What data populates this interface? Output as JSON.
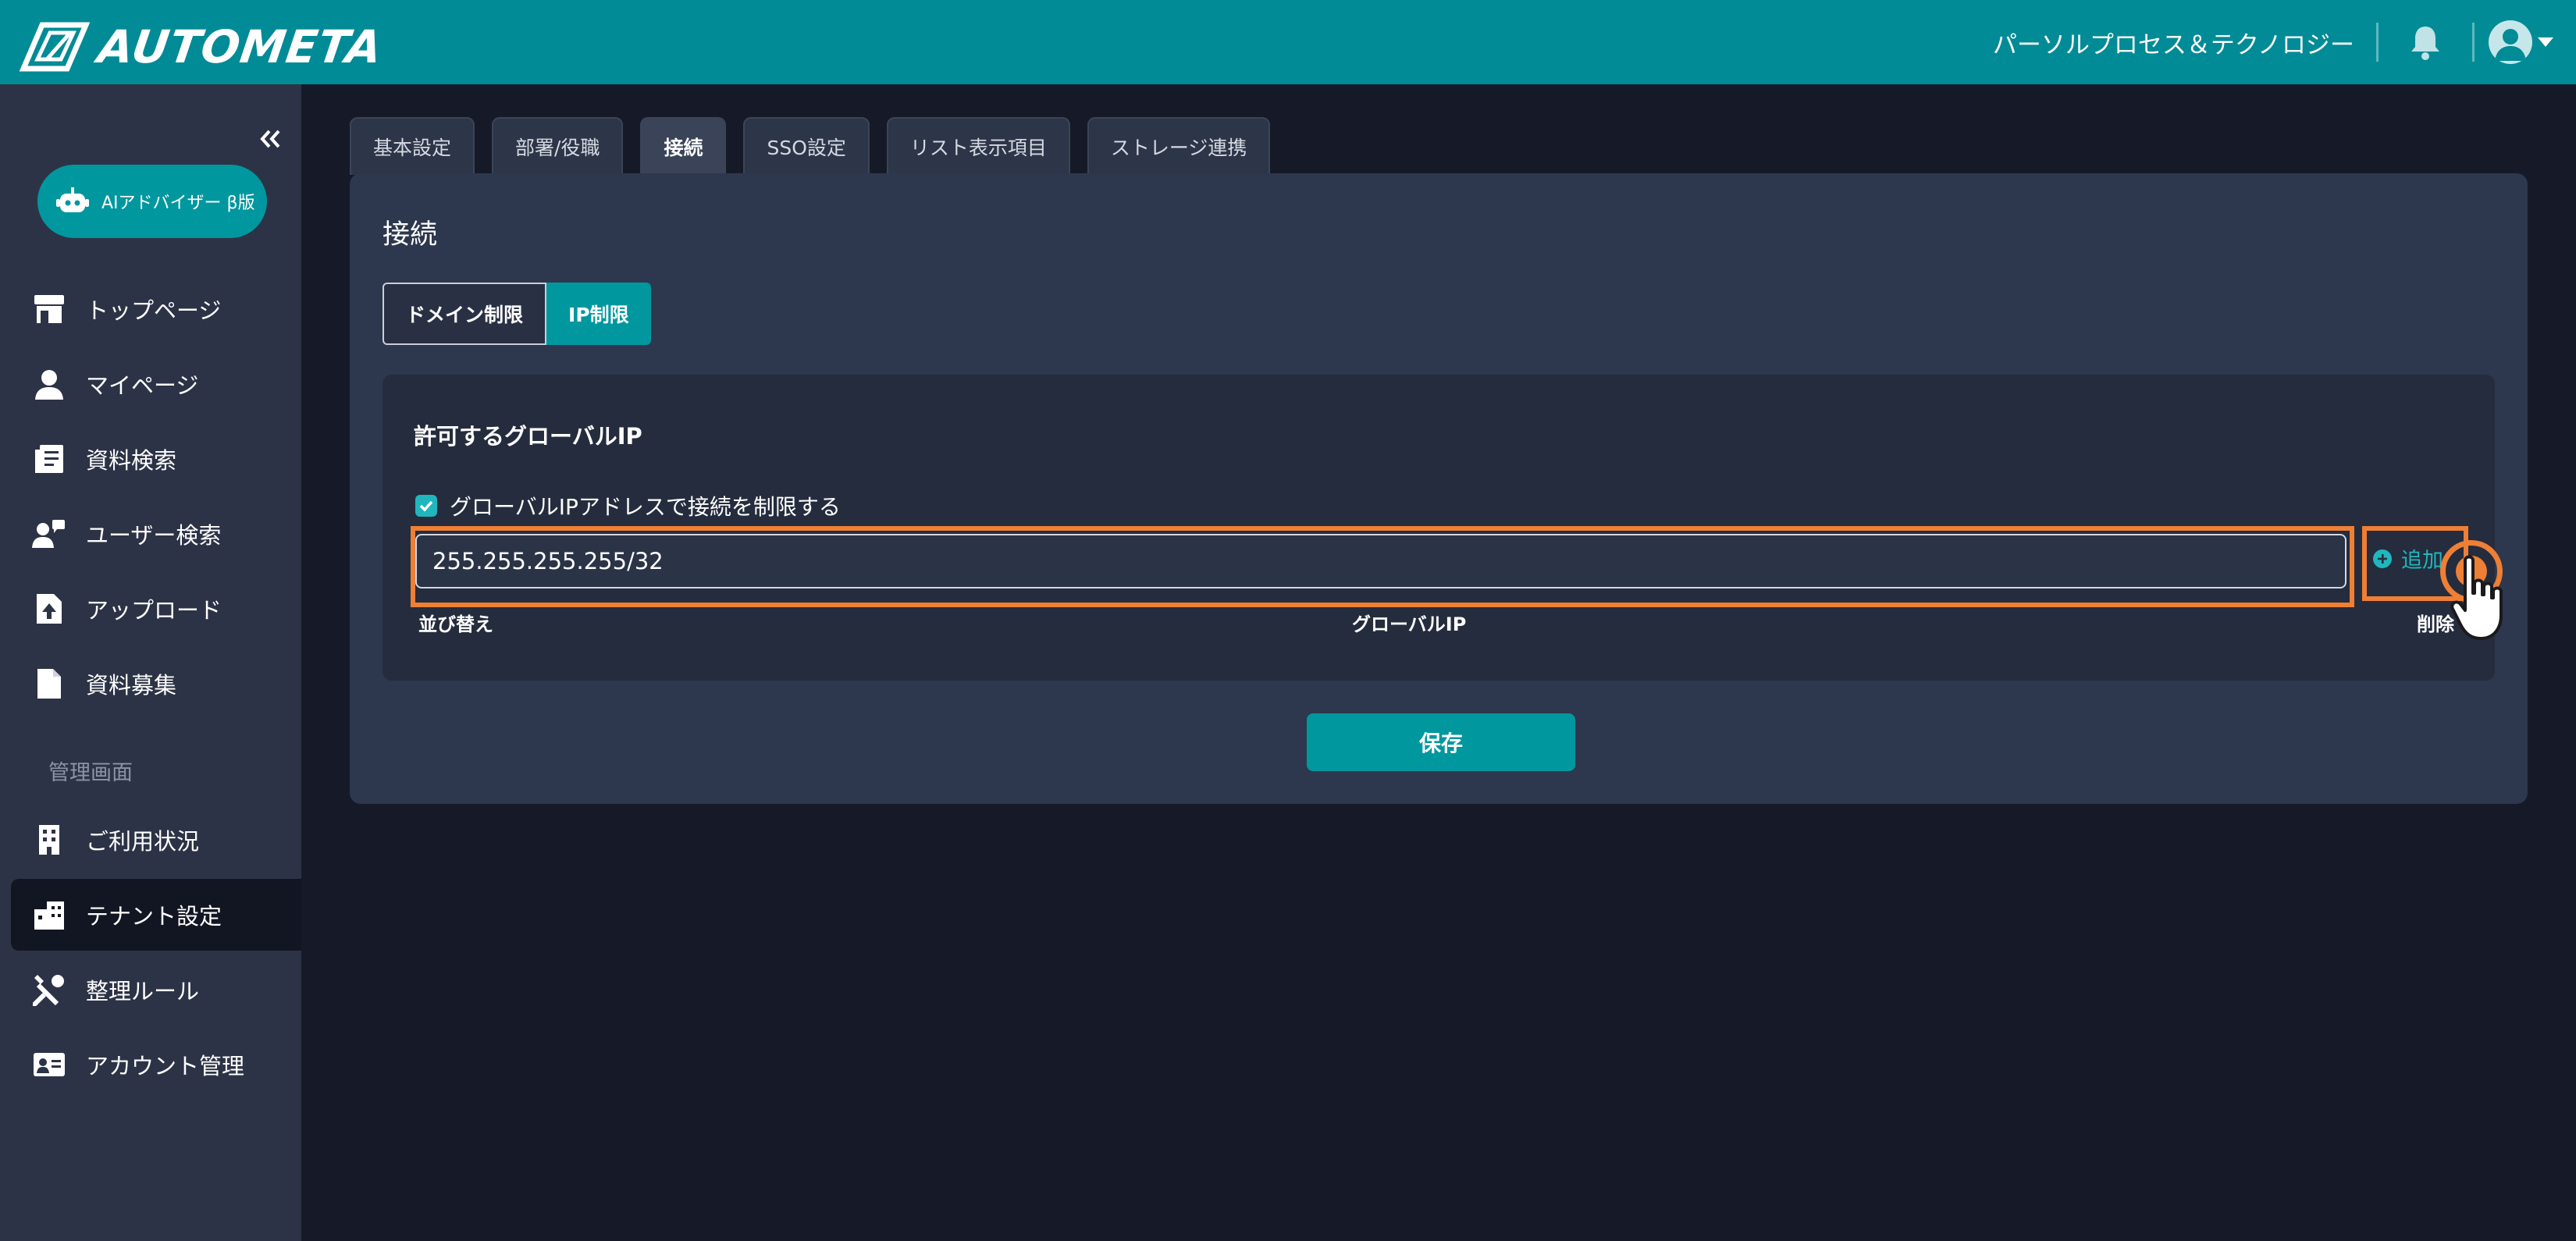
{
  "app": {
    "logo_text": "AUTOMETA",
    "company_name": "パーソルプロセス＆テクノロジー"
  },
  "sidebar": {
    "ai_button": "AIアドバイザー β版",
    "items": [
      {
        "label": "トップページ",
        "icon": "store-icon"
      },
      {
        "label": "マイページ",
        "icon": "user-icon"
      },
      {
        "label": "資料検索",
        "icon": "document-search-icon"
      },
      {
        "label": "ユーザー検索",
        "icon": "user-search-icon"
      },
      {
        "label": "アップロード",
        "icon": "upload-file-icon"
      },
      {
        "label": "資料募集",
        "icon": "file-icon"
      }
    ],
    "section_label": "管理画面",
    "admin_items": [
      {
        "label": "ご利用状況",
        "icon": "building-icon"
      },
      {
        "label": "テナント設定",
        "icon": "tenant-icon"
      },
      {
        "label": "整理ルール",
        "icon": "tools-icon"
      },
      {
        "label": "アカウント管理",
        "icon": "id-card-icon"
      }
    ]
  },
  "tabs": [
    {
      "label": "基本設定"
    },
    {
      "label": "部署/役職"
    },
    {
      "label": "接続"
    },
    {
      "label": "SSO設定"
    },
    {
      "label": "リスト表示項目"
    },
    {
      "label": "ストレージ連携"
    }
  ],
  "panel": {
    "title": "接続",
    "segments": {
      "domain": "ドメイン制限",
      "ip": "IP制限"
    },
    "card_title": "許可するグローバルIP",
    "checkbox_label": "グローバルIPアドレスで接続を制限する",
    "ip_value": "255.255.255.255/32",
    "add_label": "追加",
    "columns": {
      "sort": "並び替え",
      "ip": "グローバルIP",
      "delete": "削除"
    },
    "save_label": "保存"
  },
  "colors": {
    "brand": "#008b96",
    "accent": "#00979f",
    "highlight": "#ee7f35"
  }
}
